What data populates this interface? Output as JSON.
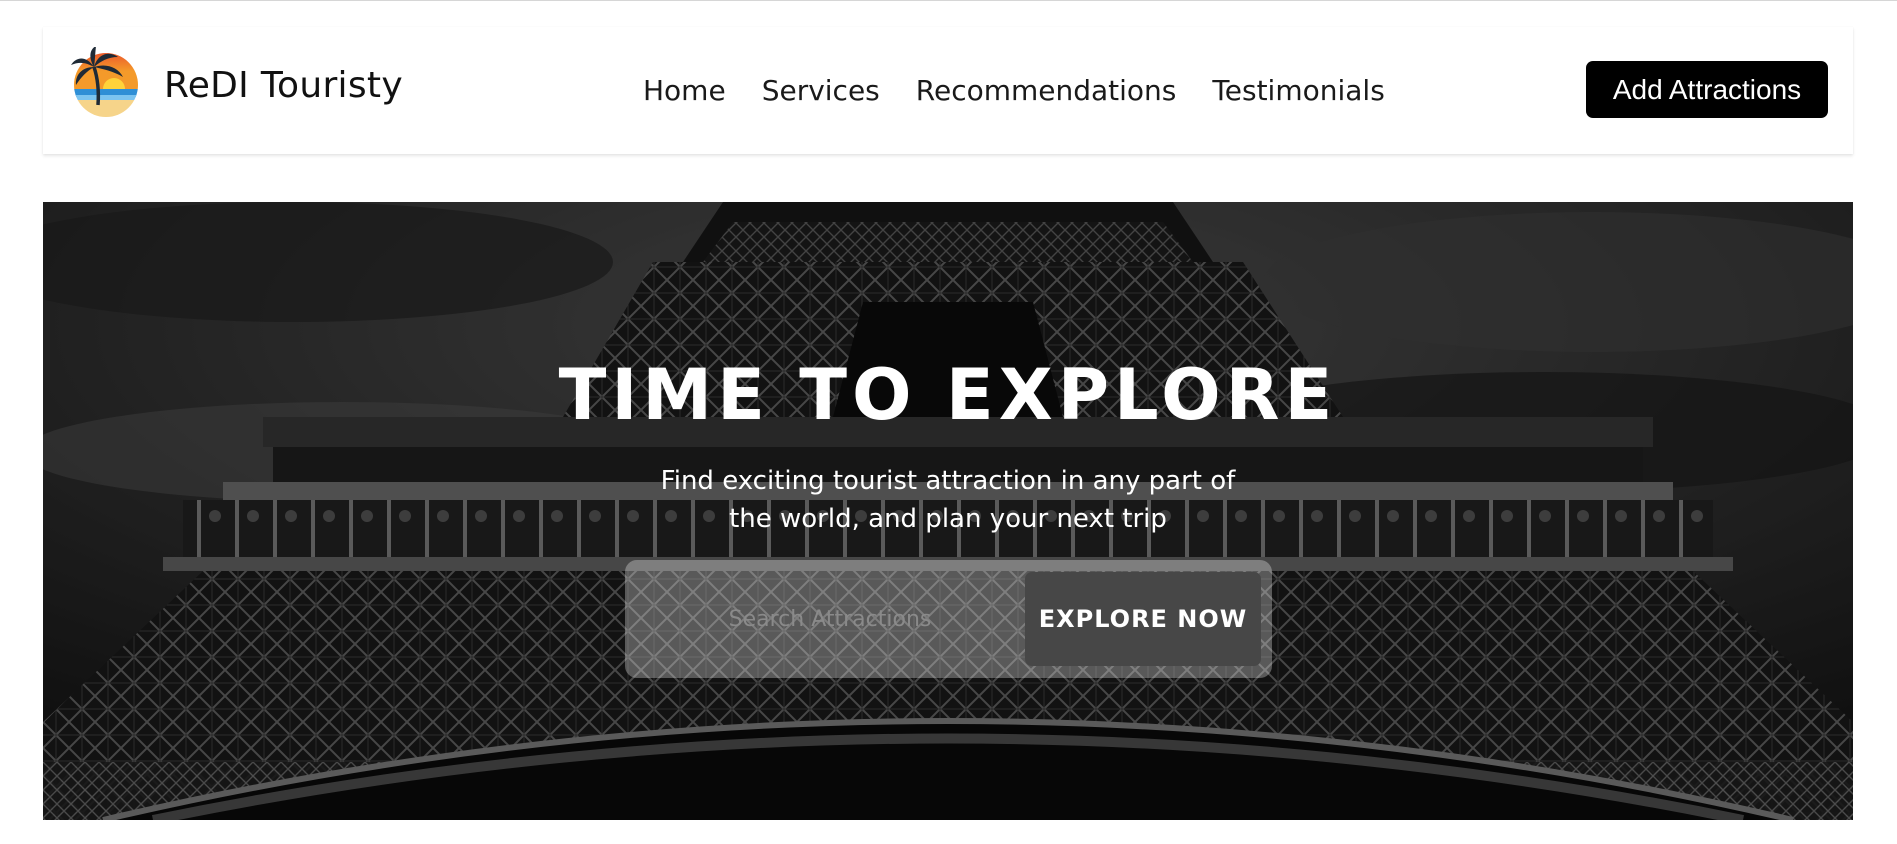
{
  "brand": {
    "name": "ReDI Touristy",
    "logo_icon": "palm-beach-sunset-logo"
  },
  "nav": {
    "links": [
      "Home",
      "Services",
      "Recommendations",
      "Testimonials"
    ]
  },
  "actions": {
    "add_attractions_label": "Add Attractions"
  },
  "hero": {
    "title": "TIME TO EXPLORE",
    "subtitle": "Find exciting tourist attraction in any part of the world, and plan your next trip",
    "background": "eiffel-tower-grayscale-photo",
    "search": {
      "placeholder": "Search Attractions",
      "value": ""
    },
    "explore_label": "EXPLORE NOW"
  },
  "colors": {
    "primary_button": "#000000",
    "explore_button": "#474747",
    "text_dark": "#111111",
    "text_light": "#ffffff"
  }
}
